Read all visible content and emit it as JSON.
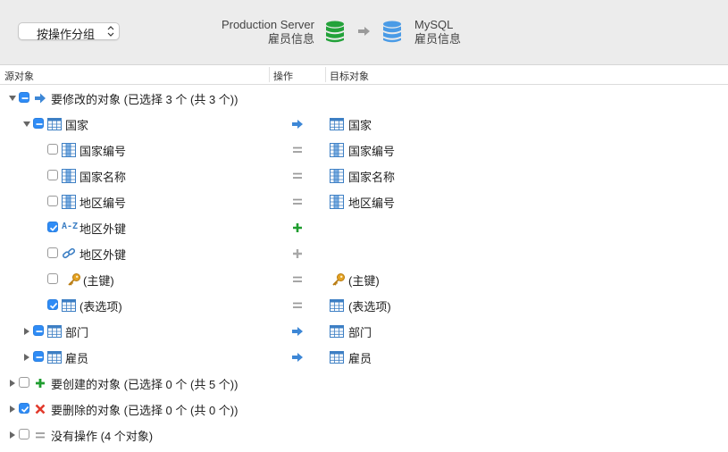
{
  "toolbar": {
    "group_select_label": "按操作分组",
    "source_server": "Production Server",
    "source_db": "雇员信息",
    "target_server": "MySQL",
    "target_db": "雇员信息"
  },
  "colors": {
    "source_db_icon": "#23a23a",
    "target_db_icon": "#4a9be6",
    "checkbox_on": "#2f8cf6",
    "arrow_blue": "#3d87d6",
    "plus_green": "#1f9d2f",
    "delete_red": "#e23a2c"
  },
  "columns": {
    "source": "源对象",
    "operation": "操作",
    "target": "目标对象"
  },
  "rows": [
    {
      "label": "要修改的对象 (已选择 3 个 (共 3 个))",
      "target": ""
    },
    {
      "label": "国家",
      "target": "国家"
    },
    {
      "label": "国家编号",
      "target": "国家编号"
    },
    {
      "label": "国家名称",
      "target": "国家名称"
    },
    {
      "label": "地区编号",
      "target": "地区编号"
    },
    {
      "label": "地区外键",
      "target": "",
      "prefix": "A-Z"
    },
    {
      "label": "地区外键",
      "target": ""
    },
    {
      "label": "(主键)",
      "target": "(主键)"
    },
    {
      "label": "(表选项)",
      "target": "(表选项)"
    },
    {
      "label": "部门",
      "target": "部门"
    },
    {
      "label": "雇员",
      "target": "雇员"
    },
    {
      "label": "要创建的对象 (已选择 0 个 (共 5 个))",
      "target": ""
    },
    {
      "label": "要删除的对象 (已选择 0 个 (共 0 个))",
      "target": ""
    },
    {
      "label": "没有操作 (4 个对象)",
      "target": ""
    }
  ]
}
